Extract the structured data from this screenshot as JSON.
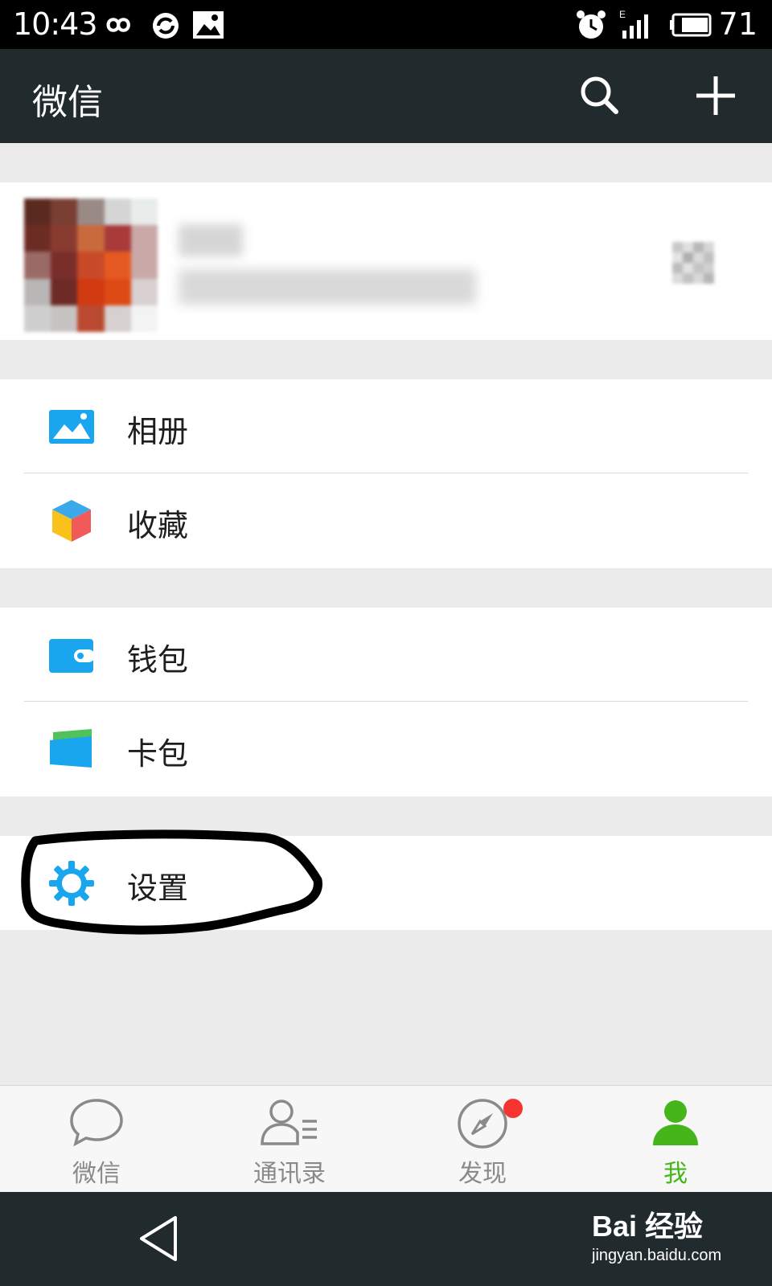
{
  "status_bar": {
    "time": "10:43",
    "battery_percent": "71",
    "network_label": "E"
  },
  "header": {
    "title": "微信"
  },
  "menu": {
    "album": "相册",
    "favorites": "收藏",
    "wallet": "钱包",
    "cards": "卡包",
    "settings": "设置"
  },
  "tabs": [
    {
      "label": "微信",
      "icon": "chat-bubble-icon",
      "active": false
    },
    {
      "label": "通讯录",
      "icon": "contacts-icon",
      "active": false
    },
    {
      "label": "发现",
      "icon": "compass-icon",
      "active": false,
      "badge": true
    },
    {
      "label": "我",
      "icon": "person-icon",
      "active": true
    }
  ],
  "watermark": {
    "logo": "Bai 经验",
    "url": "jingyan.baidu.com"
  },
  "colors": {
    "title_bar": "#212b2e",
    "active_tab": "#45b619",
    "accent_blue": "#1aa6ef",
    "badge_red": "#f43530",
    "annotation": "#000000"
  }
}
